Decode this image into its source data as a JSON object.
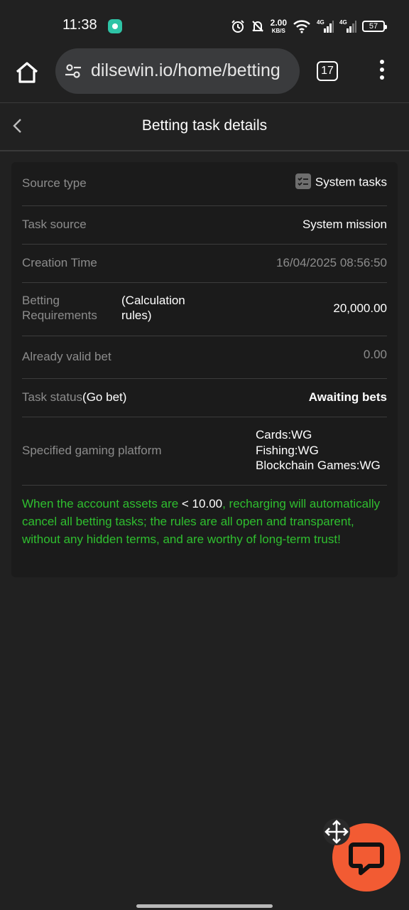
{
  "status_bar": {
    "time": "11:38",
    "net_speed_value": "2.00",
    "net_speed_unit": "KB/S",
    "signal1_label": "4G",
    "signal2_label": "4G",
    "battery": "57"
  },
  "browser": {
    "url": "dilsewin.io/home/betting",
    "tab_count": "17"
  },
  "header": {
    "title": "Betting task details"
  },
  "details": {
    "source_type_label": "Source type",
    "source_type_value": "System tasks",
    "task_source_label": "Task source",
    "task_source_value": "System mission",
    "creation_time_label": "Creation Time",
    "creation_time_value": "16/04/2025 08:56:50",
    "betting_req_label_line1": "Betting",
    "betting_req_label_line2": "Requirements",
    "calc_rules_line1": "(Calculation",
    "calc_rules_line2": "rules)",
    "betting_req_value": "20,000.00",
    "valid_bet_label": "Already valid bet",
    "valid_bet_value": "0.00",
    "task_status_label": "Task status",
    "go_bet_link": "(Go bet)",
    "task_status_value": "Awaiting bets",
    "platform_label": "Specified gaming platform",
    "platforms": [
      "Cards:WG",
      "Fishing:WG",
      "Blockchain Games:WG"
    ]
  },
  "notice": {
    "part1": "When the account assets are ",
    "threshold": "< 10.00",
    "part2": ", recharging will automatically cancel all betting tasks; the rules are all open and transparent, without any hidden terms, and are worthy of long-term trust!"
  },
  "colors": {
    "background": "#212121",
    "card": "#1b1b1b",
    "notice_green": "#2fbf2f",
    "chat_fab": "#f25b33"
  }
}
